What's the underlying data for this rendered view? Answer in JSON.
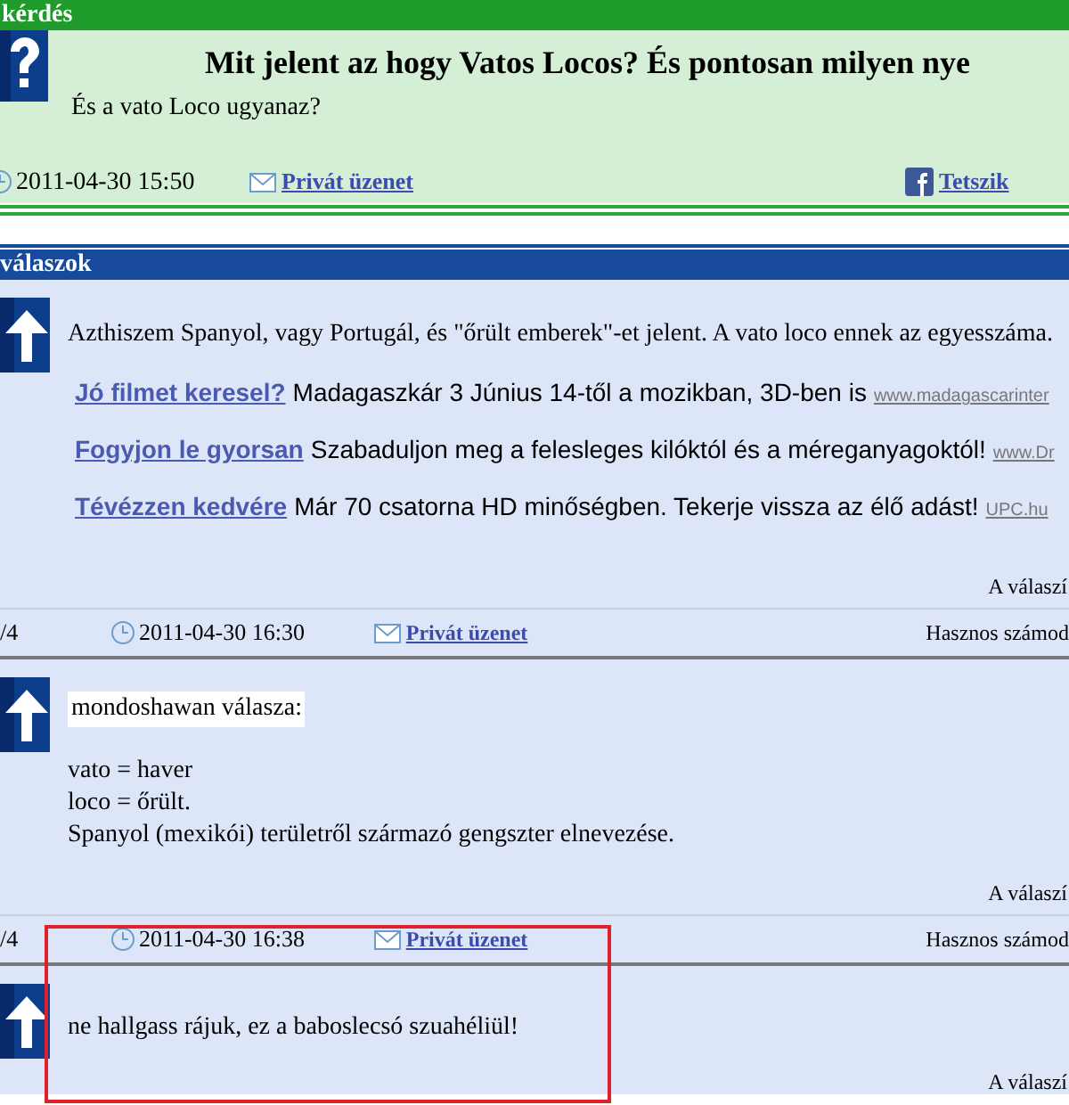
{
  "question": {
    "section_title": "kérdés",
    "title": "Mit jelent az hogy Vatos Locos? És pontosan milyen nye",
    "body": "És a vato Loco ugyanaz?",
    "date": "2011-04-30 15:50",
    "private_message": "Privát üzenet",
    "like": "Tetszik"
  },
  "answers_header": "válaszok",
  "answers": [
    {
      "highlighted": false,
      "lines": [
        "Azthiszem Spanyol, vagy Portugál, és \"őrült emberek\"-et jelent. A vato loco ennek az egyesszáma."
      ],
      "ads": [
        {
          "title": "Jó filmet keresel?",
          "text": "Madagaszkár 3 Június 14-től a mozikban, 3D-ben is",
          "url": "www.madagascarinter"
        },
        {
          "title": "Fogyjon le gyorsan",
          "text": "Szabaduljon meg a felesleges kilóktól és a méreganyagoktól!",
          "url": "www.Dr"
        },
        {
          "title": "Tévézzen kedvére",
          "text": "Már 70 csatorna HD minőségben. Tekerje vissza az élő adást!",
          "url": "UPC.hu"
        }
      ],
      "footer": "A válaszí"
    },
    {
      "highlighted": false,
      "meta": {
        "number": "/4",
        "date": "2011-04-30 16:30",
        "private_message": "Privát üzenet",
        "useful": "Hasznos számod"
      },
      "author": "mondoshawan válasza:",
      "lines": [
        "vato = haver",
        "loco = őrült.",
        "Spanyol (mexikói) területről származó gengszter elnevezése."
      ],
      "footer": "A válaszí"
    },
    {
      "highlighted": true,
      "meta": {
        "number": "/4",
        "date": "2011-04-30 16:38",
        "private_message": "Privát üzenet",
        "useful": "Hasznos számod"
      },
      "lines": [
        "ne hallgass rájuk, ez a baboslecsó szuahéliül!"
      ],
      "footer": "A válaszí"
    }
  ]
}
